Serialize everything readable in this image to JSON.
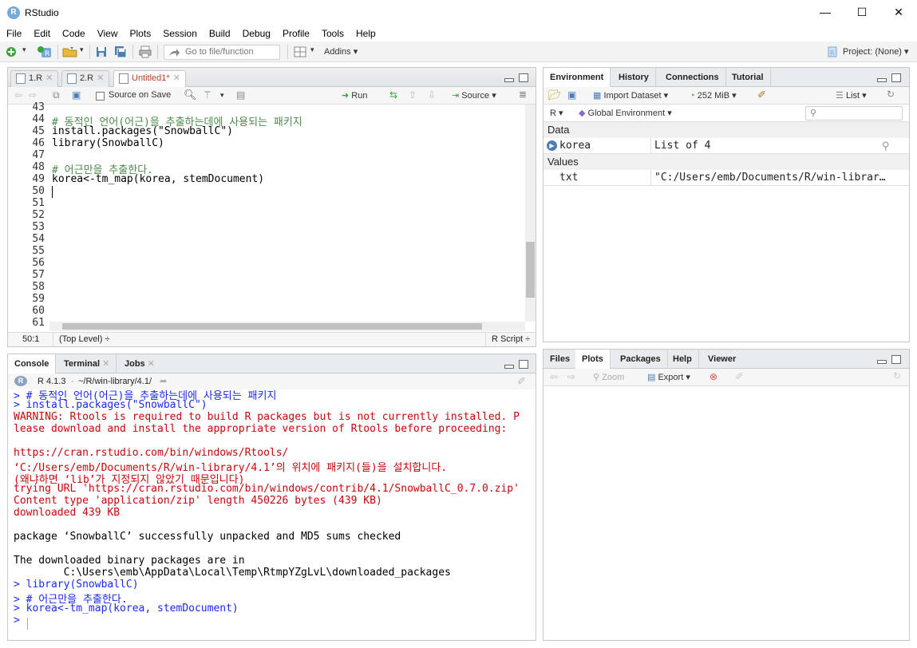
{
  "window": {
    "title": "RStudio",
    "logo_letter": "R",
    "minimize": "—",
    "maximize": "☐",
    "close": "✕"
  },
  "menu": [
    "File",
    "Edit",
    "Code",
    "View",
    "Plots",
    "Session",
    "Build",
    "Debug",
    "Profile",
    "Tools",
    "Help"
  ],
  "toolbar": {
    "goto_placeholder": "Go to file/function",
    "addins": "Addins",
    "project": "Project: (None)"
  },
  "editor": {
    "tabs": [
      {
        "label": "1.R",
        "modified": false
      },
      {
        "label": "2.R",
        "modified": false
      },
      {
        "label": "Untitled1*",
        "modified": true
      }
    ],
    "source_on_save": "Source on Save",
    "run": "Run",
    "source": "Source",
    "line_numbers": [
      "43",
      "44",
      "45",
      "46",
      "47",
      "48",
      "49",
      "50",
      "51",
      "52",
      "53",
      "54",
      "55",
      "56",
      "57",
      "58",
      "59",
      "60",
      "61"
    ],
    "code": [
      "",
      "# 동적인 언어(어근)을 추출하는데에 사용되는 패키지",
      "install.packages(\"SnowballC\")",
      "library(SnowballC)",
      "",
      "# 어근만을 추출한다.",
      "korea<-tm_map(korea, stemDocument)",
      ""
    ],
    "status_position": "50:1",
    "status_scope": "(Top Level)",
    "status_type": "R Script"
  },
  "console": {
    "tabs": [
      "Console",
      "Terminal",
      "Jobs"
    ],
    "r_version": "R 4.1.3",
    "path": "~/R/win-library/4.1/",
    "lines": [
      {
        "text": "> # 동적인 언어(어근)을 추출하는데에 사용되는 패키지",
        "color": "blue"
      },
      {
        "text": "> install.packages(\"SnowballC\")",
        "color": "blue"
      },
      {
        "text": "WARNING: Rtools is required to build R packages but is not currently installed. P",
        "color": "red"
      },
      {
        "text": "lease download and install the appropriate version of Rtools before proceeding:",
        "color": "red"
      },
      {
        "text": "",
        "color": "red"
      },
      {
        "text": "https://cran.rstudio.com/bin/windows/Rtools/",
        "color": "red"
      },
      {
        "text": "‘C:/Users/emb/Documents/R/win-library/4.1’의 위치에 패키지(들)을 설치합니다.",
        "color": "red"
      },
      {
        "text": "(왜냐하면 ‘lib’가 지정되지 않았기 때문입니다)",
        "color": "red"
      },
      {
        "text": "trying URL 'https://cran.rstudio.com/bin/windows/contrib/4.1/SnowballC_0.7.0.zip'",
        "color": "red"
      },
      {
        "text": "Content type 'application/zip' length 450226 bytes (439 KB)",
        "color": "red"
      },
      {
        "text": "downloaded 439 KB",
        "color": "red"
      },
      {
        "text": "",
        "color": "black"
      },
      {
        "text": "package ‘SnowballC’ successfully unpacked and MD5 sums checked",
        "color": "black"
      },
      {
        "text": "",
        "color": "black"
      },
      {
        "text": "The downloaded binary packages are in",
        "color": "black"
      },
      {
        "text": "        C:\\Users\\emb\\AppData\\Local\\Temp\\RtmpYZgLvL\\downloaded_packages",
        "color": "black"
      },
      {
        "text": "> library(SnowballC)",
        "color": "blue"
      },
      {
        "text": "> # 어근만을 추출한다.",
        "color": "blue"
      },
      {
        "text": "> korea<-tm_map(korea, stemDocument)",
        "color": "blue"
      },
      {
        "text": "> ",
        "color": "blue"
      }
    ]
  },
  "environment": {
    "tabs": [
      "Environment",
      "History",
      "Connections",
      "Tutorial"
    ],
    "import_dataset": "Import Dataset",
    "memory": "252 MiB",
    "view_mode": "List",
    "language": "R",
    "scope": "Global Environment",
    "data_header": "Data",
    "values_header": "Values",
    "data_rows": [
      {
        "name": "korea",
        "value": "List of  4"
      }
    ],
    "value_rows": [
      {
        "name": "txt",
        "value": "\"C:/Users/emb/Documents/R/win-librar…"
      }
    ]
  },
  "files": {
    "tabs": [
      "Files",
      "Plots",
      "Packages",
      "Help",
      "Viewer"
    ],
    "zoom": "Zoom",
    "export": "Export"
  },
  "colors": {
    "accent": "#75aadb",
    "console_blue": "#1a2ae8",
    "console_red": "#c5060b",
    "comment_green": "#4d8b4d"
  }
}
